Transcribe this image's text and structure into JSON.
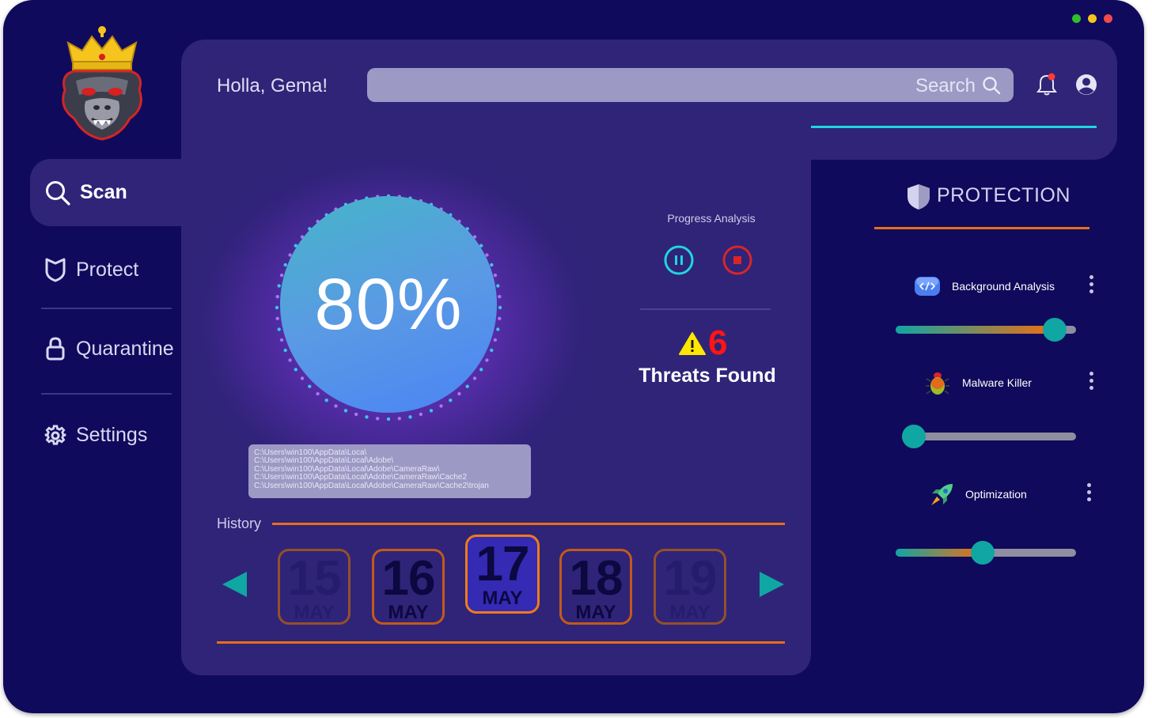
{
  "window": {
    "controls": [
      {
        "name": "minimize",
        "color": "#2ec12c"
      },
      {
        "name": "maximize",
        "color": "#f5c51e"
      },
      {
        "name": "close",
        "color": "#f04b4b"
      }
    ]
  },
  "logo": {
    "icon": "crowned-gorilla-logo"
  },
  "sidebar": {
    "items": [
      {
        "label": "Scan",
        "icon": "search-icon",
        "active": true
      },
      {
        "label": "Protect",
        "icon": "shield-icon"
      },
      {
        "label": "Quarantine",
        "icon": "lock-icon"
      },
      {
        "label": "Settings",
        "icon": "gear-icon"
      }
    ]
  },
  "header": {
    "greeting": "Holla, Gema!",
    "search_placeholder": "Search",
    "icons": [
      "bell-icon",
      "user-icon"
    ]
  },
  "scan": {
    "progress_text": "80%",
    "progress_value": 0.8,
    "progress_title": "Progress Analysis",
    "threat_count": "6",
    "threat_label": "Threats Found",
    "paths": [
      "C:\\Users\\win100\\AppData\\Loca\\",
      "C:\\Users\\win100\\AppData\\Local\\Adobe\\",
      "C:\\Users\\win100\\AppData\\Local\\Adobe\\CameraRaw\\",
      "C:\\Users\\win100\\AppData\\Local\\Adobe\\CameraRaw\\Cache2",
      "C:\\Users\\win100\\AppData\\Local\\Adobe\\CameraRaw\\Cache2\\trojan"
    ]
  },
  "history": {
    "label": "History",
    "dates": [
      {
        "day": "15",
        "month": "MAY",
        "state": "faded"
      },
      {
        "day": "16",
        "month": "MAY",
        "state": "normal"
      },
      {
        "day": "17",
        "month": "MAY",
        "state": "active"
      },
      {
        "day": "18",
        "month": "MAY",
        "state": "normal"
      },
      {
        "day": "19",
        "month": "MAY",
        "state": "faded"
      }
    ]
  },
  "protection": {
    "title": "PROTECTION",
    "items": [
      {
        "label": "Background Analysis",
        "icon": "code-icon",
        "level": 0.94
      },
      {
        "label": "Malware Killer",
        "icon": "bug-icon",
        "level": 0.0
      },
      {
        "label": "Optimization",
        "icon": "rocket-icon",
        "level": 0.48
      }
    ]
  },
  "colors": {
    "background": "#100a5c",
    "panel": "#2f2478",
    "accent_cyan": "#1ed6e0",
    "accent_orange": "#e86e1b",
    "knob": "#10a6a3",
    "threat_red": "#ff1515"
  }
}
